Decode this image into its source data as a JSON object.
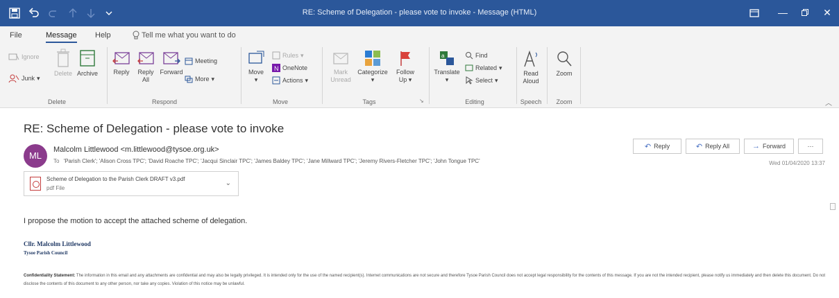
{
  "window": {
    "title": "RE: Scheme of Delegation - please vote to invoke  -  Message (HTML)"
  },
  "menu": {
    "tabs": [
      "File",
      "Message",
      "Help"
    ],
    "tell_me": "Tell me what you want to do"
  },
  "ribbon": {
    "delete_group": {
      "label": "Delete",
      "ignore": "Ignore",
      "junk": "Junk",
      "delete": "Delete",
      "archive": "Archive"
    },
    "respond_group": {
      "label": "Respond",
      "reply": "Reply",
      "reply_all_1": "Reply",
      "reply_all_2": "All",
      "forward": "Forward",
      "meeting": "Meeting",
      "more": "More"
    },
    "move_group": {
      "label": "Move",
      "move": "Move",
      "rules": "Rules",
      "onenote": "OneNote",
      "actions": "Actions"
    },
    "tags_group": {
      "label": "Tags",
      "mark_unread_1": "Mark",
      "mark_unread_2": "Unread",
      "categorize": "Categorize",
      "follow_up_1": "Follow",
      "follow_up_2": "Up"
    },
    "editing_group": {
      "label": "Editing",
      "translate": "Translate",
      "find": "Find",
      "related": "Related",
      "select": "Select"
    },
    "speech_group": {
      "label": "Speech",
      "read_aloud_1": "Read",
      "read_aloud_2": "Aloud"
    },
    "zoom_group": {
      "label": "Zoom",
      "zoom": "Zoom"
    }
  },
  "message": {
    "subject": "RE: Scheme of Delegation - please vote to invoke",
    "avatar_initials": "ML",
    "sender": "Malcolm Littlewood <m.littlewood@tysoe.org.uk>",
    "to_label": "To",
    "recipients": "'Parish Clerk'; 'Alison Cross TPC'; 'David Roache TPC'; 'Jacqui Sinclair TPC'; 'James Baldey TPC'; 'Jane Millward TPC'; 'Jeremy Rivers-Fletcher TPC'; 'John Tongue TPC'",
    "date": "Wed 01/04/2020 13:37",
    "actions": {
      "reply": "Reply",
      "reply_all": "Reply All",
      "forward": "Forward",
      "more": "···"
    },
    "attachment": {
      "name": "Scheme of Delegation to the Parish Clerk DRAFT v3.pdf",
      "type": "pdf File"
    },
    "body": "I propose the motion to accept the attached scheme of delegation.",
    "signature_name": "Cllr. Malcolm Littlewood",
    "signature_org": "Tysoe Parish Council",
    "confidentiality_heading": "Confidentiality Statement:",
    "confidentiality_text": "The information in this email and any attachments are confidential and may also be legally privileged. It is intended only for the use of the named recipient(s). Internet communications are not secure and therefore Tysoe Parish Council does not accept legal responsibility for the contents of this message. If you are not the intended recipient, please notify us immediately and then delete this document. Do not disclose the contents of this document to any other person, nor take any copies. Violation of this notice may be unlawful."
  },
  "colors": {
    "titlebar": "#2b579a",
    "avatar": "#8b3b8c",
    "signature": "#1f3864"
  }
}
